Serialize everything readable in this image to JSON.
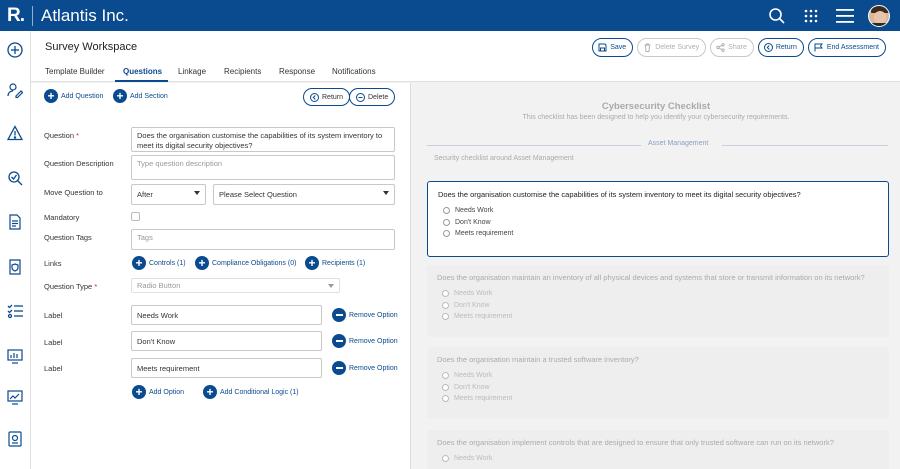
{
  "app": {
    "logo": "R.",
    "brand": "Atlantis Inc."
  },
  "header": {
    "title": "Survey Workspace",
    "save": "Save",
    "delete_survey": "Delete Survey",
    "share": "Share",
    "return": "Return",
    "end_assessment": "End Assessment"
  },
  "tabs": [
    "Template Builder",
    "Questions",
    "Linkage",
    "Recipients",
    "Response",
    "Notifications"
  ],
  "editor": {
    "add_question": "Add Question",
    "add_section": "Add Section",
    "return": "Return",
    "delete": "Delete",
    "labels": {
      "question": "Question",
      "required_mark": "*",
      "question_description": "Question Description",
      "move_question_to": "Move Question to",
      "mandatory": "Mandatory",
      "question_tags": "Question Tags",
      "links": "Links",
      "question_type": "Question Type",
      "label": "Label"
    },
    "question_value": "Does the organisation customise the capabilities of its system inventory to meet its digital security objectives?",
    "description_placeholder": "Type question description",
    "move_position": "After",
    "move_target_placeholder": "Please Select Question",
    "tags_placeholder": "Tags",
    "links": {
      "controls": "Controls (1)",
      "compliance": "Compliance Obligations (0)",
      "recipients": "Recipients (1)"
    },
    "question_type": "Radio Button",
    "options": [
      "Needs Work",
      "Don't Know",
      "Meets requirement"
    ],
    "remove_option": "Remove Option",
    "add_option": "Add Option",
    "add_conditional_logic": "Add Conditional Logic (1)"
  },
  "preview": {
    "title": "Cybersecurity Checklist",
    "subtitle": "This checklist has been designed to help you identify your cybersecurity requirements.",
    "section_title": "Asset Management",
    "section_description": "Security checklist around Asset Management",
    "questions": [
      {
        "text": "Does the organisation customise the capabilities of its system inventory to meet its digital security objectives?",
        "options": [
          "Needs Work",
          "Don't Know",
          "Meets requirement"
        ]
      },
      {
        "text": "Does the organisation maintain an inventory of all physical devices and systems that store or transmit information on its network?",
        "options": [
          "Needs Work",
          "Don't Know",
          "Meets requirement"
        ]
      },
      {
        "text": "Does the organisation maintain a trusted software inventory?",
        "options": [
          "Needs Work",
          "Don't Know",
          "Meets requirement"
        ]
      },
      {
        "text": "Does the organisation implement controls that are designed to ensure that only trusted software can run on its network?",
        "options": [
          "Needs Work"
        ]
      }
    ]
  },
  "colors": {
    "brand": "#0a4a8f",
    "required": "#d9232e"
  }
}
